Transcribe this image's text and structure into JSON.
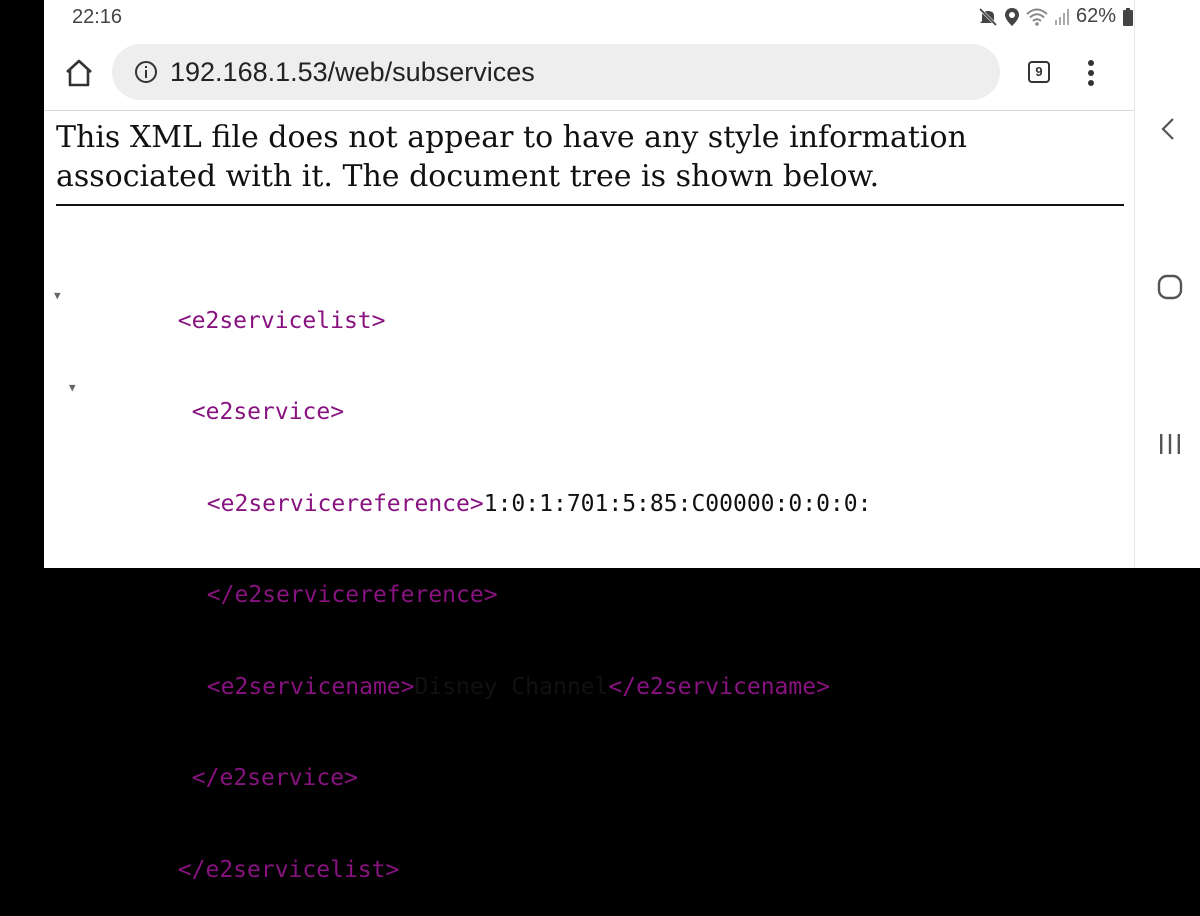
{
  "status_bar": {
    "time": "22:16",
    "battery": "62%"
  },
  "browser": {
    "url": "192.168.1.53/web/subservices",
    "tab_count": "9"
  },
  "page": {
    "notice": "This XML file does not appear to have any style information associated with it. The document tree is shown below.",
    "tree": {
      "servicelist_open": "<e2servicelist>",
      "service_open": "<e2service>",
      "reference_open": "<e2servicereference>",
      "reference_value": "1:0:1:701:5:85:C00000:0:0:0:",
      "reference_close": "</e2servicereference>",
      "name_open": "<e2servicename>",
      "name_value": "Disney Channel",
      "name_close": "</e2servicename>",
      "service_close": "</e2service>",
      "servicelist_close": "</e2servicelist>"
    }
  },
  "icons": {
    "home": "home-icon",
    "info": "info-icon",
    "menu": "more-vert-icon",
    "mute": "mute-icon",
    "location": "location-icon",
    "wifi": "wifi-icon",
    "signal": "signal-icon",
    "battery": "battery-icon",
    "nav_back": "back-chevron-icon",
    "nav_home": "home-circle-icon",
    "nav_recents": "recents-icon"
  },
  "colors": {
    "xml_tag": "#881280",
    "url_bar_bg": "#eeeeee"
  }
}
